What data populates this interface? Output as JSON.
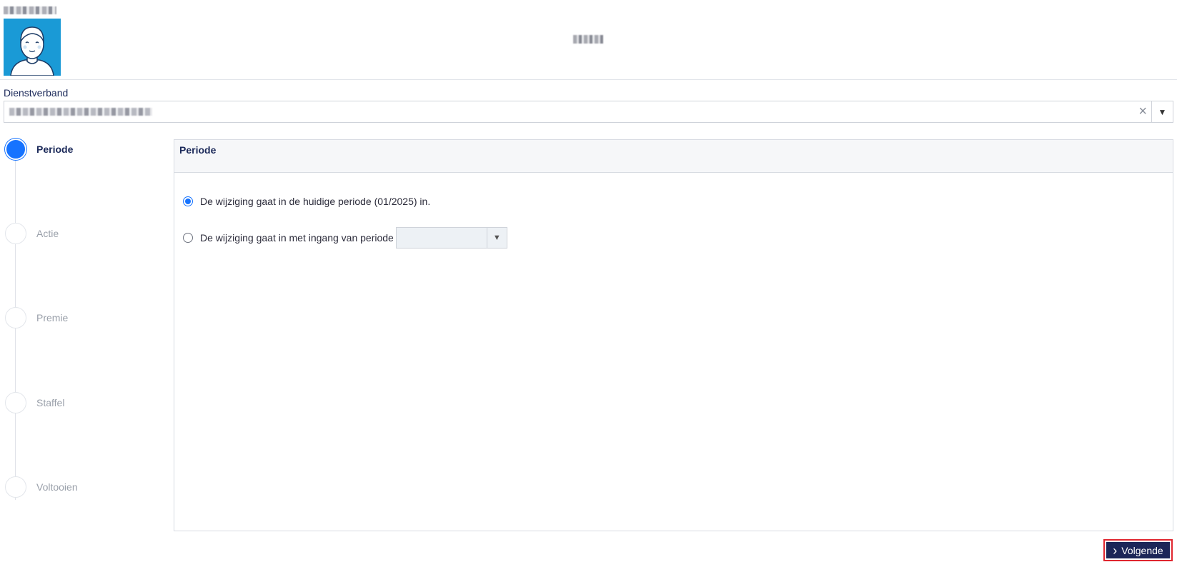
{
  "header": {
    "avatar_icon": "user-avatar-icon",
    "avatar_bg": "#1a9ad6"
  },
  "dienstverband": {
    "label": "Dienstverband",
    "clear_icon": "×",
    "dropdown_icon": "▼"
  },
  "stepper": {
    "steps": [
      {
        "label": "Periode",
        "active": true
      },
      {
        "label": "Actie",
        "active": false
      },
      {
        "label": "Premie",
        "active": false
      },
      {
        "label": "Staffel",
        "active": false
      },
      {
        "label": "Voltooien",
        "active": false
      }
    ],
    "active_color": "#1673ff"
  },
  "panel": {
    "title": "Periode",
    "option_current": "De wijziging gaat in de huidige periode (01/2025) in.",
    "option_from": "De wijziging gaat in met ingang van periode",
    "selected_option": "current",
    "period_select_value": "",
    "dropdown_icon": "▼"
  },
  "footer": {
    "next_label": "Volgende",
    "next_icon": "›",
    "button_color": "#1c2658"
  }
}
